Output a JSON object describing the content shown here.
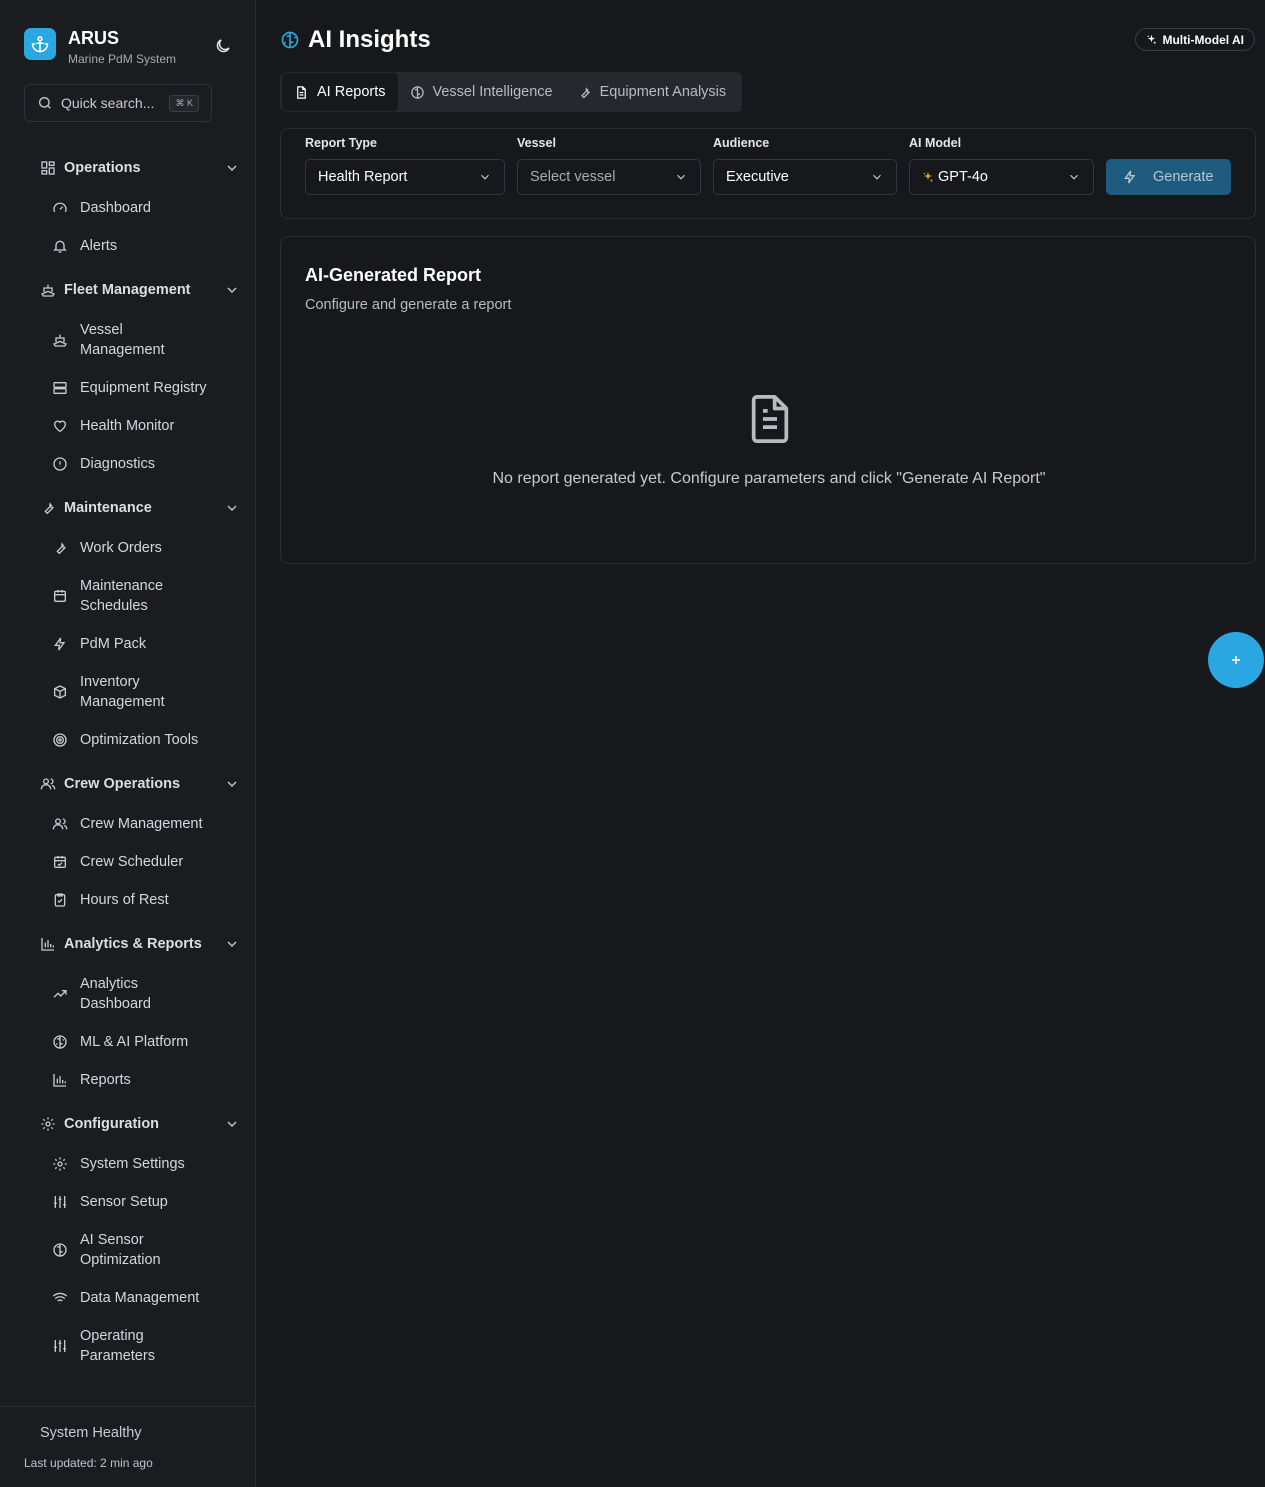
{
  "brand": {
    "title": "ARUS",
    "subtitle": "Marine PdM System"
  },
  "search": {
    "placeholder": "Quick search...",
    "shortcut": "⌘ K"
  },
  "sidebar": {
    "groups": [
      {
        "label": "Operations",
        "items": [
          {
            "label": "Dashboard"
          },
          {
            "label": "Alerts"
          }
        ]
      },
      {
        "label": "Fleet Management",
        "items": [
          {
            "label": "Vessel Management"
          },
          {
            "label": "Equipment Registry"
          },
          {
            "label": "Health Monitor"
          },
          {
            "label": "Diagnostics"
          }
        ]
      },
      {
        "label": "Maintenance",
        "items": [
          {
            "label": "Work Orders"
          },
          {
            "label": "Maintenance Schedules"
          },
          {
            "label": "PdM Pack"
          },
          {
            "label": "Inventory Management"
          },
          {
            "label": "Optimization Tools"
          }
        ]
      },
      {
        "label": "Crew Operations",
        "items": [
          {
            "label": "Crew Management"
          },
          {
            "label": "Crew Scheduler"
          },
          {
            "label": "Hours of Rest"
          }
        ]
      },
      {
        "label": "Analytics & Reports",
        "items": [
          {
            "label": "Analytics Dashboard"
          },
          {
            "label": "ML & AI Platform"
          },
          {
            "label": "Reports"
          }
        ]
      },
      {
        "label": "Configuration",
        "items": [
          {
            "label": "System Settings"
          },
          {
            "label": "Sensor Setup"
          },
          {
            "label": "AI Sensor Optimization"
          },
          {
            "label": "Data Management"
          },
          {
            "label": "Operating Parameters"
          }
        ]
      }
    ],
    "footer": {
      "status": "System Healthy",
      "updated": "Last updated: 2 min ago"
    }
  },
  "page": {
    "title": "AI Insights",
    "badge": "Multi-Model AI"
  },
  "tabs": [
    {
      "label": "AI Reports"
    },
    {
      "label": "Vessel Intelligence"
    },
    {
      "label": "Equipment Analysis"
    }
  ],
  "form": {
    "report_type": {
      "label": "Report Type",
      "value": "Health Report"
    },
    "vessel": {
      "label": "Vessel",
      "placeholder": "Select vessel"
    },
    "audience": {
      "label": "Audience",
      "value": "Executive"
    },
    "ai_model": {
      "label": "AI Model",
      "value": "GPT-4o"
    },
    "generate": "Generate"
  },
  "report": {
    "title": "AI-Generated Report",
    "subtitle": "Configure and generate a report",
    "empty": "No report generated yet. Configure parameters and click \"Generate AI Report\""
  },
  "colors": {
    "accent": "#2aa7e0",
    "generate_bg": "#1e5b7e",
    "background": "#17181c"
  },
  "fab": {
    "icon": "plus-icon"
  }
}
